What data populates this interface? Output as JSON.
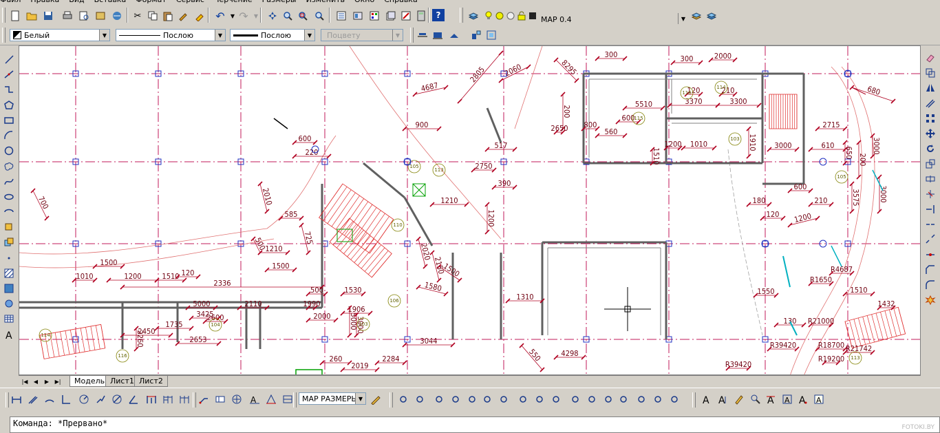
{
  "menu": [
    "Файл",
    "Правка",
    "Вид",
    "Вставка",
    "Формат",
    "Сервис",
    "Черчение",
    "Размеры",
    "Изменить",
    "Окно",
    "Справка"
  ],
  "layer": {
    "current": "МАР 0.4"
  },
  "properties": {
    "color": "Белый",
    "linetype": "Послою",
    "lineweight": "Послою",
    "plotstyle": "Поцвету"
  },
  "dimstyle": {
    "current": "МАР РАЗМЕРЫ"
  },
  "tabs": [
    {
      "label": "Модель",
      "active": true
    },
    {
      "label": "Лист1",
      "active": false
    },
    {
      "label": "Лист2",
      "active": false
    }
  ],
  "command": {
    "text": "Команда: *Прервано*"
  },
  "watermark": "FOTOKI.BY",
  "icons": {
    "standard": [
      "new-icon",
      "open-icon",
      "save-icon",
      "print-icon",
      "preview-icon",
      "publish-icon",
      "3d-dwf-icon",
      "cut-icon",
      "copy-icon",
      "paste-icon",
      "matchprop-icon",
      "undo-icon",
      "redo-icon",
      "pan-icon",
      "zoom-realtime-icon",
      "zoom-window-icon",
      "zoom-previous-icon",
      "properties-icon",
      "design-center-icon",
      "tool-palettes-icon",
      "sheet-set-icon",
      "markup-icon",
      "calculator-icon",
      "help-icon"
    ],
    "draw": [
      "line-icon",
      "construction-line-icon",
      "polyline-icon",
      "polygon-icon",
      "rectangle-icon",
      "arc-icon",
      "circle-icon",
      "revcloud-icon",
      "spline-icon",
      "ellipse-icon",
      "ellipse-arc-icon",
      "insert-block-icon",
      "make-block-icon",
      "point-icon",
      "hatch-icon",
      "gradient-icon",
      "region-icon",
      "table-icon",
      "mtext-icon"
    ],
    "modify": [
      "erase-icon",
      "copy-object-icon",
      "mirror-icon",
      "offset-icon",
      "array-icon",
      "move-icon",
      "rotate-icon",
      "scale-icon",
      "stretch-icon",
      "trim-icon",
      "extend-icon",
      "break-at-point-icon",
      "break-icon",
      "join-icon",
      "chamfer-icon",
      "fillet-icon",
      "explode-icon"
    ]
  },
  "drawing": {
    "dimensions": [
      "300",
      "300",
      "2000",
      "8295",
      "2060",
      "2805",
      "4687",
      "5510",
      "3370",
      "3300",
      "120",
      "210",
      "200",
      "2650",
      "800",
      "560",
      "600",
      "1510",
      "1200",
      "1010",
      "1910",
      "3000",
      "610",
      "2715",
      "650",
      "200",
      "3575",
      "3000",
      "2750",
      "390",
      "517",
      "900",
      "600",
      "220",
      "1210",
      "1200",
      "1310",
      "1500",
      "1210",
      "1500",
      "1010",
      "1200",
      "1510",
      "2336",
      "120",
      "500",
      "5000",
      "2110",
      "1990",
      "2000",
      "1906",
      "1530",
      "1735",
      "2600",
      "2450",
      "2653",
      "2260",
      "3425",
      "260",
      "2019",
      "2284",
      "3044",
      "4298",
      "550",
      "1550",
      "130",
      "R21000",
      "R18700",
      "R19200",
      "R21742",
      "R39420",
      "R39420",
      "R1650",
      "R4687",
      "1510",
      "1432",
      "2010",
      "500",
      "585",
      "725",
      "700",
      "680",
      "1200",
      "600",
      "180",
      "120",
      "210",
      "3000",
      "1580",
      "1500",
      "2020",
      "2150",
      "5000",
      "3000"
    ],
    "rooms": [
      "105",
      "113",
      "114",
      "116",
      "115",
      "103",
      "110",
      "106",
      "104",
      "103"
    ]
  }
}
